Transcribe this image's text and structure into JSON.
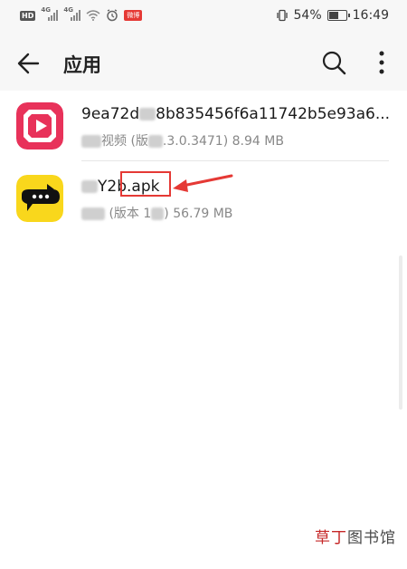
{
  "status_bar": {
    "hd": "HD",
    "signal1": "4G",
    "signal2": "4G",
    "badge": "微博",
    "battery_percent": "54%",
    "battery_level": 0.54,
    "time": "16:49"
  },
  "header": {
    "title": "应用"
  },
  "icons": {
    "back": "back-arrow-icon",
    "search": "search-icon",
    "more": "more-vert-icon"
  },
  "apps": [
    {
      "name": "9ea72d",
      "name_rest": "8b835456f6a11742b5e93a6...",
      "meta_prefix": "",
      "meta_mid": "视频 (版",
      "meta_rest": ".3.0.3471) 8.94 MB",
      "brand_color": "#e8325a"
    },
    {
      "name": "Y2b",
      "name_ext": ".apk",
      "meta_mid": "(版本 1",
      "meta_rest": ") 56.79 MB",
      "brand_color": "#f9d71c"
    }
  ],
  "watermark": {
    "red": "草丁",
    "rest": "图书馆"
  },
  "colors": {
    "accent_red": "#e53935"
  }
}
